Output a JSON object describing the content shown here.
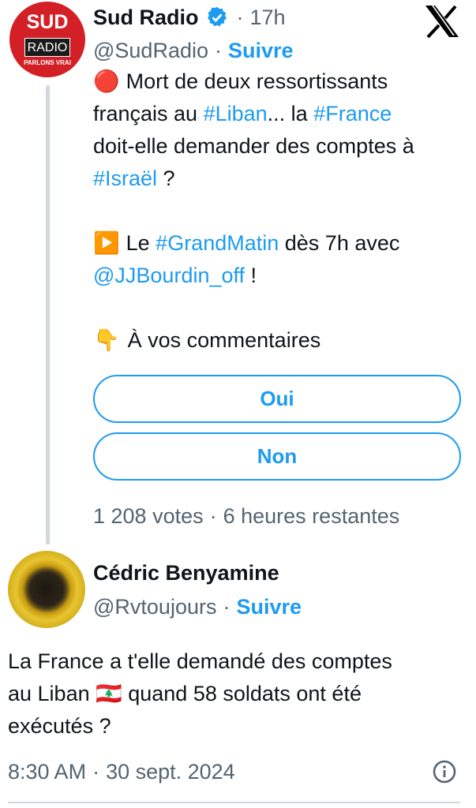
{
  "tweet": {
    "author": {
      "name": "Sud Radio",
      "handle": "@SudRadio",
      "time": "17h",
      "follow_label": "Suivre",
      "avatar": {
        "top_text": "SUD",
        "box_text": "RADIO",
        "tagline": "PARLONS VRAI",
        "color": "#d32027"
      },
      "verified_color": "#1d9bf0"
    },
    "text": {
      "line1_emoji": "🔴",
      "line1": "Mort de deux ressortissants",
      "line2_a": "français au ",
      "tag_liban": "#Liban",
      "line2_b": "... la ",
      "tag_france": "#France",
      "line3": "doit-elle demander des comptes à",
      "tag_israel": "#Israël",
      "line4_b": " ?",
      "line5_emoji": "▶️",
      "line5_a": "Le ",
      "tag_grandmatin": "#GrandMatin",
      "line5_b": " dès 7h avec",
      "mention": "@JJBourdin_off",
      "line6_b": " !",
      "line7_emoji": "👇",
      "line7": "À vos commentaires"
    },
    "poll": {
      "options": [
        "Oui",
        "Non"
      ],
      "votes": "1 208 votes",
      "remaining": "6 heures restantes"
    }
  },
  "reply": {
    "author": {
      "name": "Cédric Benyamine",
      "handle": "@Rvtoujours",
      "follow_label": "Suivre"
    },
    "line1": "La France a t'elle demandé des comptes",
    "line2_a": "au Liban ",
    "flag": "🇱🇧",
    "line2_b": " quand 58 soldats ont été",
    "line3": "exécutés ?",
    "time": "8:30 AM",
    "date": "30 sept. 2024"
  },
  "icons": [
    "x-logo-icon",
    "verified-badge-icon",
    "info-icon",
    "red-circle-icon",
    "play-button-icon",
    "pointing-down-icon",
    "lebanon-flag-icon"
  ],
  "colors": {
    "accent": "#1d9bf0",
    "text": "#0f1419",
    "secondary": "#536471"
  }
}
